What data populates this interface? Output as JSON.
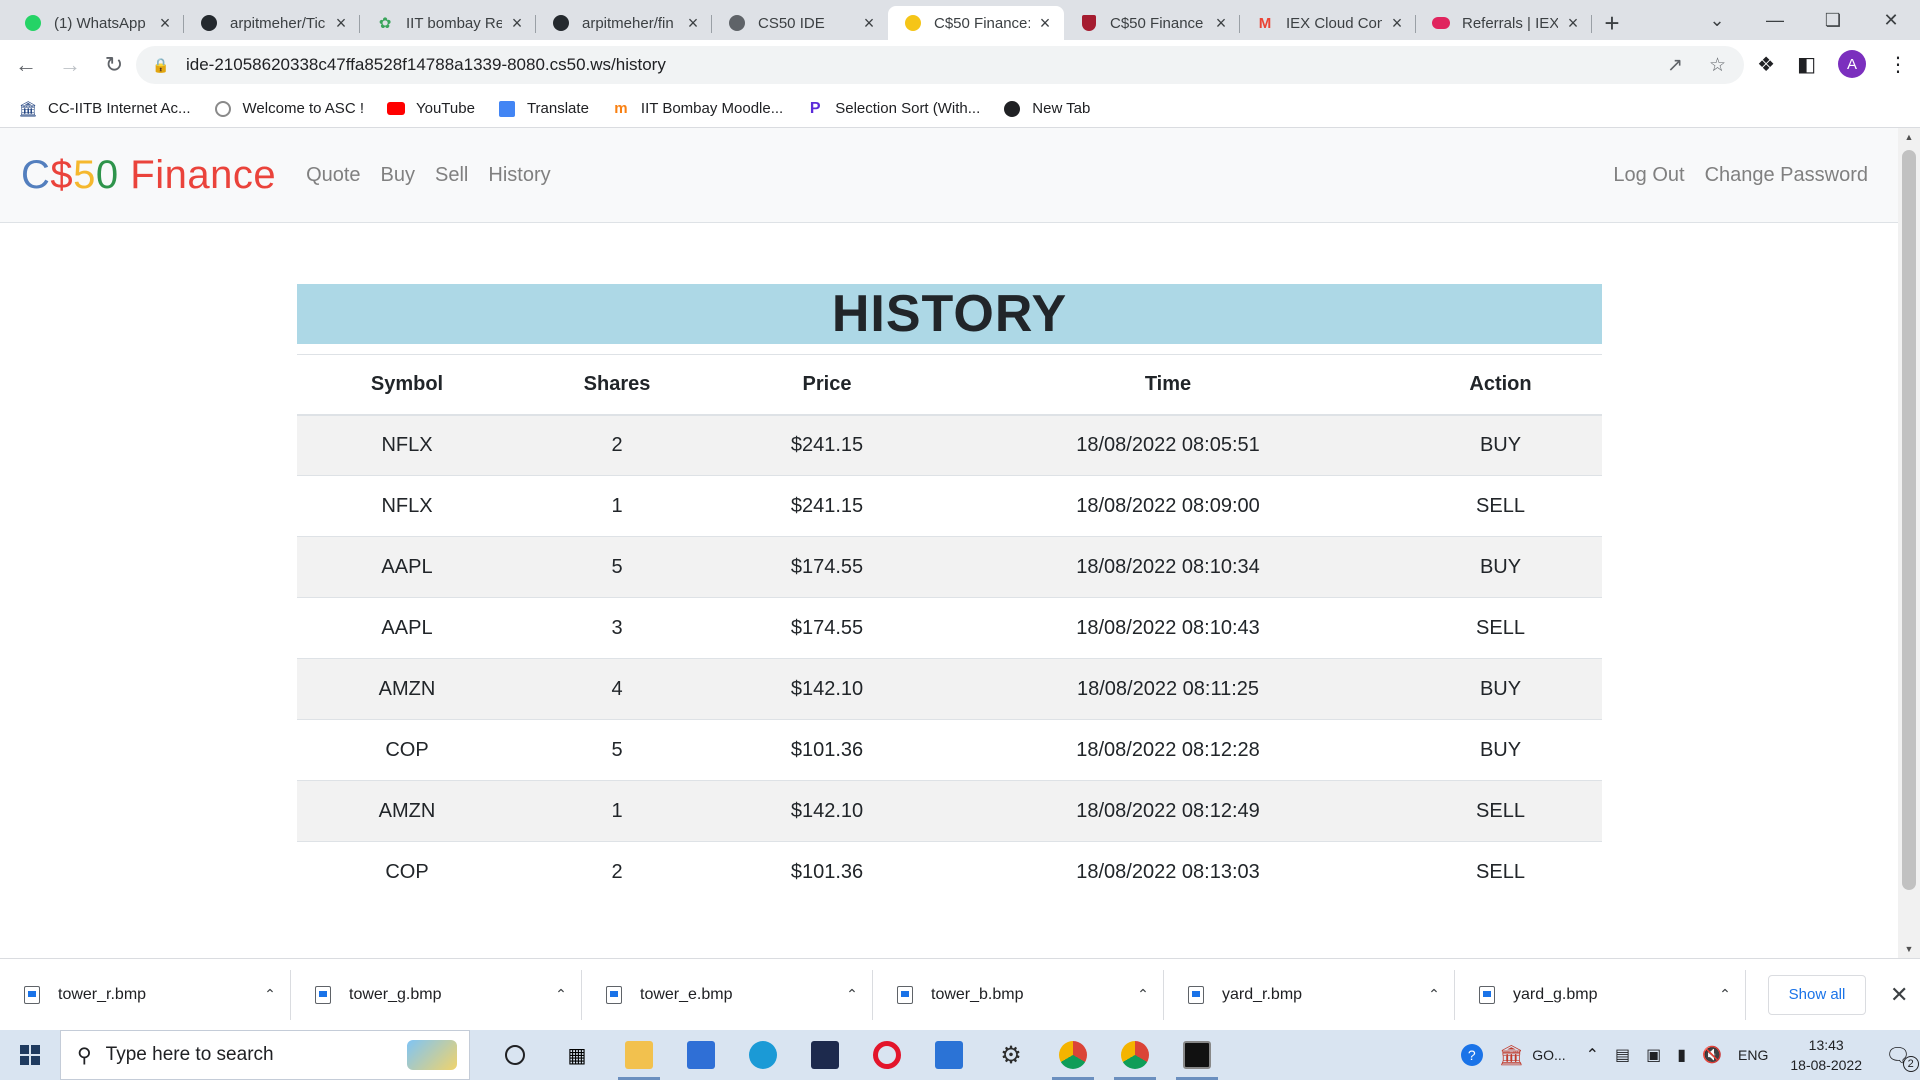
{
  "browser": {
    "tabs": [
      {
        "title": "(1) WhatsApp",
        "icon": "whatsapp-icon"
      },
      {
        "title": "arpitmeher/Tic",
        "icon": "github-icon"
      },
      {
        "title": "IIT bombay Re",
        "icon": "leaf-icon"
      },
      {
        "title": "arpitmeher/fin",
        "icon": "github-icon"
      },
      {
        "title": "CS50 IDE",
        "icon": "globe-icon"
      },
      {
        "title": "C$50 Finance:",
        "icon": "money-face-icon"
      },
      {
        "title": "C$50 Finance",
        "icon": "harvard-shield-icon"
      },
      {
        "title": "IEX Cloud Con",
        "icon": "gmail-icon"
      },
      {
        "title": "Referrals | IEX",
        "icon": "cloud-icon"
      }
    ],
    "active_tab_index": 5,
    "url": "ide-21058620338c47ffa8528f14788a1339-8080.cs50.ws/history",
    "avatar_letter": "A",
    "bookmarks": [
      {
        "label": "CC-IITB Internet Ac...",
        "icon": "building-icon"
      },
      {
        "label": "Welcome to ASC !",
        "icon": "seal-icon"
      },
      {
        "label": "YouTube",
        "icon": "youtube-icon"
      },
      {
        "label": "Translate",
        "icon": "translate-icon"
      },
      {
        "label": "IIT Bombay Moodle...",
        "icon": "moodle-icon"
      },
      {
        "label": "Selection Sort (With...",
        "icon": "p-logo-icon"
      },
      {
        "label": "New Tab",
        "icon": "globe-icon"
      }
    ]
  },
  "app": {
    "brand": {
      "c": "C",
      "dollar": "$",
      "five": "5",
      "zero": "0",
      "finance": " Finance"
    },
    "nav_left": [
      "Quote",
      "Buy",
      "Sell",
      "History"
    ],
    "nav_right": [
      "Log Out",
      "Change Password"
    ],
    "heading": "HISTORY",
    "columns": [
      "Symbol",
      "Shares",
      "Price",
      "Time",
      "Action"
    ],
    "rows": [
      [
        "NFLX",
        "2",
        "$241.15",
        "18/08/2022 08:05:51",
        "BUY"
      ],
      [
        "NFLX",
        "1",
        "$241.15",
        "18/08/2022 08:09:00",
        "SELL"
      ],
      [
        "AAPL",
        "5",
        "$174.55",
        "18/08/2022 08:10:34",
        "BUY"
      ],
      [
        "AAPL",
        "3",
        "$174.55",
        "18/08/2022 08:10:43",
        "SELL"
      ],
      [
        "AMZN",
        "4",
        "$142.10",
        "18/08/2022 08:11:25",
        "BUY"
      ],
      [
        "COP",
        "5",
        "$101.36",
        "18/08/2022 08:12:28",
        "BUY"
      ],
      [
        "AMZN",
        "1",
        "$142.10",
        "18/08/2022 08:12:49",
        "SELL"
      ],
      [
        "COP",
        "2",
        "$101.36",
        "18/08/2022 08:13:03",
        "SELL"
      ]
    ],
    "colors": {
      "header_bg": "#add8e6",
      "brand_blue": "#537fbe",
      "brand_red": "#ea433b",
      "brand_yellow": "#f5b82e",
      "brand_green": "#2e944b"
    }
  },
  "downloads": {
    "files": [
      "tower_r.bmp",
      "tower_g.bmp",
      "tower_e.bmp",
      "tower_b.bmp",
      "yard_r.bmp",
      "yard_g.bmp"
    ],
    "show_all": "Show all"
  },
  "taskbar": {
    "search_placeholder": "Type here to search",
    "tray_app_label": "GO...",
    "language": "ENG",
    "time": "13:43",
    "date": "18-08-2022",
    "notification_count": "2"
  }
}
